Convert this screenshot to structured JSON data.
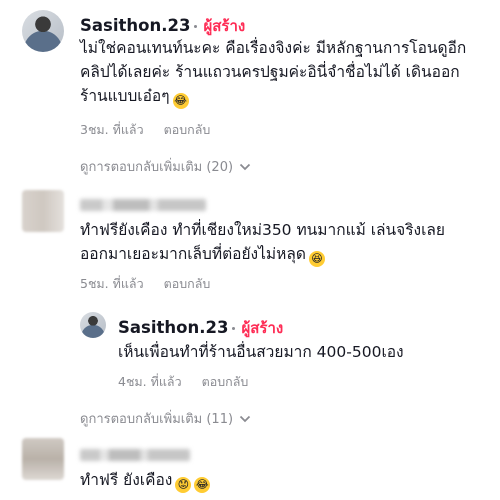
{
  "comments": [
    {
      "username": "Sasithon.23",
      "creator_badge": "ผู้สร้าง",
      "text_lines": [
        "ไม่ใช่คอนเทนท์นะคะ คือเรื่องจิงค่ะ มีหลักฐานการโอนดูอีก",
        "คลิปได้เลยค่ะ ร้านแถวนครปฐมค่ะอินี่จำชื่อไม่ได้ เดินออก",
        "ร้านแบบเอ๋อๆ"
      ],
      "emoji": "rofl-emoji",
      "time": "3ชม. ที่แล้ว",
      "reply": "ตอบกลับ"
    },
    {
      "text_lines": [
        "ทำฟรียังเคือง ทำที่เชียงใหม่350 ทนมากแม้ เล่นจริงเลย",
        "ออกมาเยอะมากเล็บที่ต่อยังไม่หลุด"
      ],
      "emoji": "squint-laugh-emoji",
      "time": "5ชม. ที่แล้ว",
      "reply": "ตอบกลับ"
    },
    {
      "text_lines": [
        "ทำฟรี ยังเคือง"
      ],
      "emoji": "worried-emoji"
    }
  ],
  "replies": [
    {
      "username": "Sasithon.23",
      "creator_badge": "ผู้สร้าง",
      "text": "เห็นเพื่อนทำที่ร้านอื่นสวยมาก 400-500เอง",
      "time": "4ชม. ที่แล้ว",
      "reply": "ตอบกลับ"
    }
  ],
  "view_more": [
    "ดูการตอบกลับเพิ่มเติม (20)",
    "ดูการตอบกลับเพิ่มเติม (11)"
  ],
  "colors": {
    "creator": "#fe2c55",
    "meta": "#8a8b91",
    "text": "#161823"
  }
}
